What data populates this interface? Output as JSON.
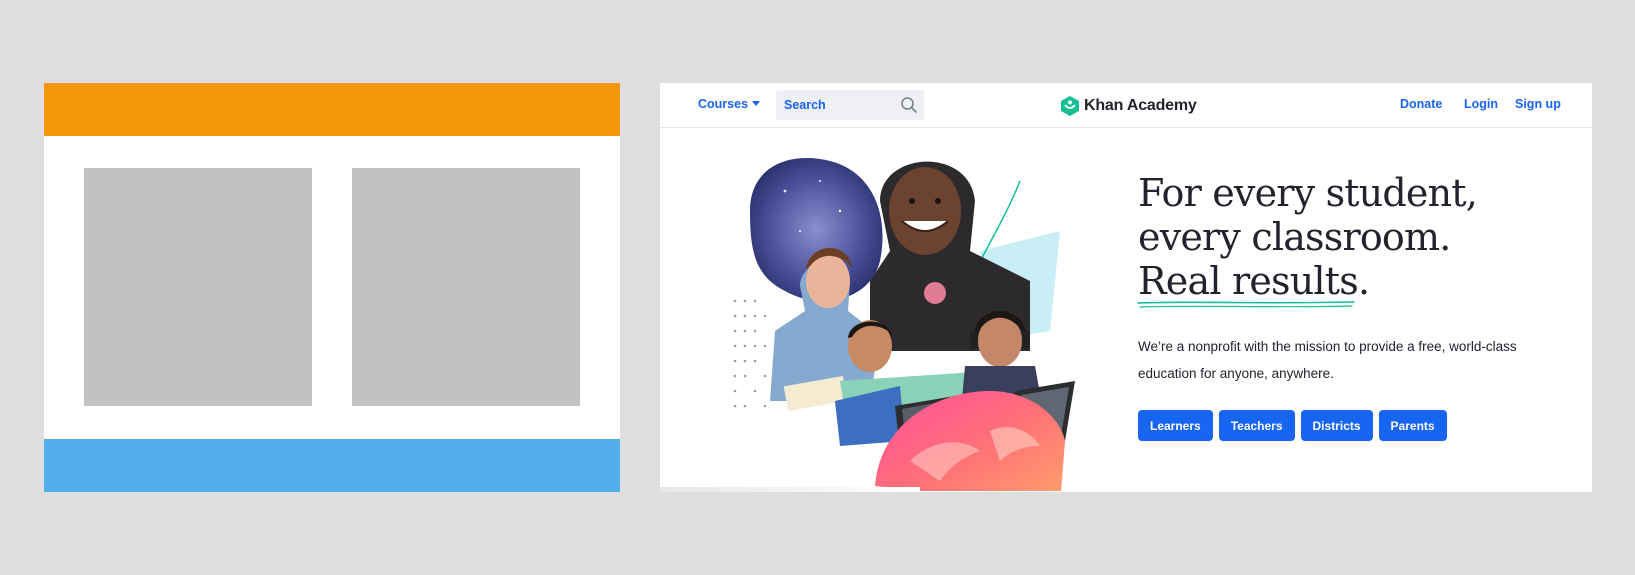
{
  "colors": {
    "background": "#dedede",
    "wire_header": "#f39609",
    "wire_footer": "#50adea",
    "wire_block": "#c2c2c2",
    "brand_blue": "#1865f2",
    "brand_green": "#14bf96",
    "text_dark": "#21242c"
  },
  "nav": {
    "courses_label": "Courses",
    "courses_icon": "chevron-down-icon",
    "search_placeholder": "Search",
    "search_icon": "search-icon",
    "logo_text": "Khan Academy",
    "logo_icon": "hexagon-logo-icon",
    "links": {
      "donate": "Donate",
      "login": "Login",
      "signup": "Sign up"
    }
  },
  "hero": {
    "headline": [
      "For every student,",
      "every classroom.",
      "Real results."
    ],
    "mission": "We’re a nonprofit with the mission to provide a free, world-class education for anyone, anywhere.",
    "buttons": [
      "Learners",
      "Teachers",
      "Districts",
      "Parents"
    ]
  }
}
